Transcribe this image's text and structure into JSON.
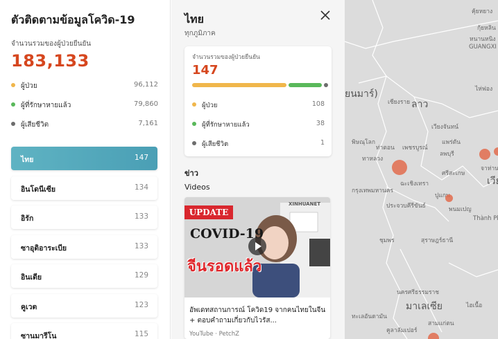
{
  "app": {
    "title": "ตัวติดตามข้อมูลโควิด-19",
    "total_label": "จำนวนรวมของผู้ป่วยยืนยัน",
    "total_value": "183,133",
    "stats": [
      {
        "label": "ผู้ป่วย",
        "value": "96,112",
        "color": "#f0b64b"
      },
      {
        "label": "ผู้ที่รักษาหายแล้ว",
        "value": "79,860",
        "color": "#59b85a"
      },
      {
        "label": "ผู้เสียชีวิต",
        "value": "7,161",
        "color": "#6d6d6d"
      }
    ]
  },
  "countries": [
    {
      "name": "ไทย",
      "count": "147"
    },
    {
      "name": "อินโดนีเซีย",
      "count": "134"
    },
    {
      "name": "อิรัก",
      "count": "133"
    },
    {
      "name": "ซาอุดิอาระเบีย",
      "count": "133"
    },
    {
      "name": "อินเดีย",
      "count": "129"
    },
    {
      "name": "คูเวต",
      "count": "123"
    },
    {
      "name": "ซานมารีโน",
      "count": "115"
    }
  ],
  "detail": {
    "title": "ไทย",
    "subtitle": "ทุกภูมิภาค",
    "card_label": "จำนวนรวมของผู้ป่วยยืนยัน",
    "card_value": "147",
    "progress": {
      "active": 108,
      "recovered": 38,
      "deaths": 1
    },
    "stats": [
      {
        "label": "ผู้ป่วย",
        "value": "108",
        "color": "#f0b64b"
      },
      {
        "label": "ผู้ที่รักษาหายแล้ว",
        "value": "38",
        "color": "#59b85a"
      },
      {
        "label": "ผู้เสียชีวิต",
        "value": "1",
        "color": "#6d6d6d"
      }
    ],
    "news_heading": "ข่าว",
    "videos_heading": "Videos",
    "video": {
      "badge": "UPDATE",
      "thumb_headline": "COVID-19",
      "thumb_caption": "จีนรอดแล้ว",
      "brand": "XINHUANET",
      "title": "อัพเดทสถานการณ์ โควิด19 จากคนไทยในจีน + ตอบคำถามเกี่ยวกับไวรัส...",
      "source": "YouTube · PetchZ"
    }
  },
  "map": {
    "labels": [
      {
        "text": "คุ้ยหยาง"
      },
      {
        "text": "กุ้ยหลิน"
      },
      {
        "text": "หนานหนิง"
      },
      {
        "text": "GUANGXI Z"
      },
      {
        "text": "ไห่ฟอง"
      },
      {
        "text": "ยนมาร์)"
      },
      {
        "text": "เชียงราย"
      },
      {
        "text": "ลาว"
      },
      {
        "text": "เวียงจันทน์"
      },
      {
        "text": "พิษณุโลก"
      },
      {
        "text": "ท่าตอน"
      },
      {
        "text": "ทาหลวง"
      },
      {
        "text": "เพชรบูรณ์"
      },
      {
        "text": "แพร่ตัน"
      },
      {
        "text": "ลพบุรี"
      },
      {
        "text": "ศรีสะเกษ"
      },
      {
        "text": "ฉะเชิงเทรา"
      },
      {
        "text": "ปูแกน"
      },
      {
        "text": "กรุงเทพมหานคร"
      },
      {
        "text": "ประจวบคีรีขันธ์"
      },
      {
        "text": "พนมเปญ"
      },
      {
        "text": "Thành Phố"
      },
      {
        "text": "ชุมพร"
      },
      {
        "text": "นครศรีธรรมราช"
      },
      {
        "text": "สุราษฎร์ธานี"
      },
      {
        "text": "ทะเลอันดามัน"
      },
      {
        "text": "มาเลเซีย"
      },
      {
        "text": "เวีย"
      },
      {
        "text": "จาห่านง"
      },
      {
        "text": "ไฮเนื้อ"
      },
      {
        "text": "สามแก่ตน"
      },
      {
        "text": "คูลาลัมเปอร์"
      }
    ],
    "bubbles": [
      {
        "name": "Bangkok"
      },
      {
        "name": "Eastern"
      },
      {
        "name": "Phnom Penh"
      },
      {
        "name": "Central Vietnam"
      },
      {
        "name": "Kuala Lumpur"
      }
    ]
  }
}
